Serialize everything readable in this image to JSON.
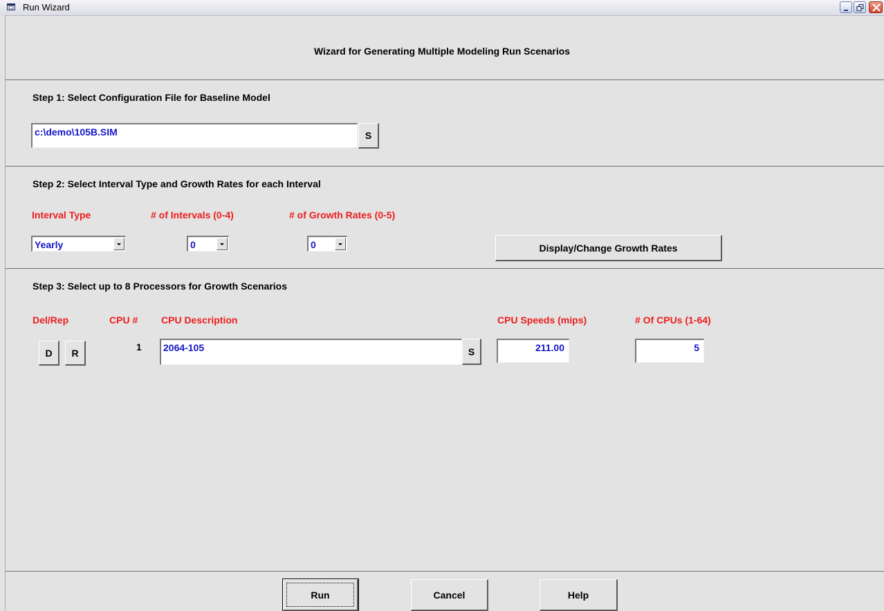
{
  "window": {
    "title": "Run Wizard"
  },
  "header": {
    "title": "Wizard for Generating Multiple Modeling Run Scenarios"
  },
  "step1": {
    "title": "Step 1: Select Configuration File for Baseline Model",
    "config_file": "c:\\demo\\105B.SIM",
    "select_label": "S"
  },
  "step2": {
    "title": "Step 2: Select Interval Type and Growth Rates for each Interval",
    "interval_type_label": "Interval Type",
    "intervals_label": "# of Intervals (0-4)",
    "growth_rates_label": "# of Growth Rates (0-5)",
    "interval_type_value": "Yearly",
    "intervals_value": "0",
    "growth_rates_value": "0",
    "display_button": "Display/Change Growth Rates"
  },
  "step3": {
    "title": "Step 3: Select up to 8 Processors for Growth Scenarios",
    "columns": {
      "del_rep": "Del/Rep",
      "cpu_num": "CPU #",
      "cpu_desc": "CPU Description",
      "cpu_speed": "CPU Speeds (mips)",
      "num_cpus": "# Of CPUs (1-64)"
    },
    "rows": [
      {
        "delete_label": "D",
        "replace_label": "R",
        "cpu_num": "1",
        "description": "2064-105",
        "select_label": "S",
        "speed": "211.00",
        "count": "5"
      }
    ]
  },
  "footer": {
    "run": "Run",
    "cancel": "Cancel",
    "help": "Help"
  }
}
